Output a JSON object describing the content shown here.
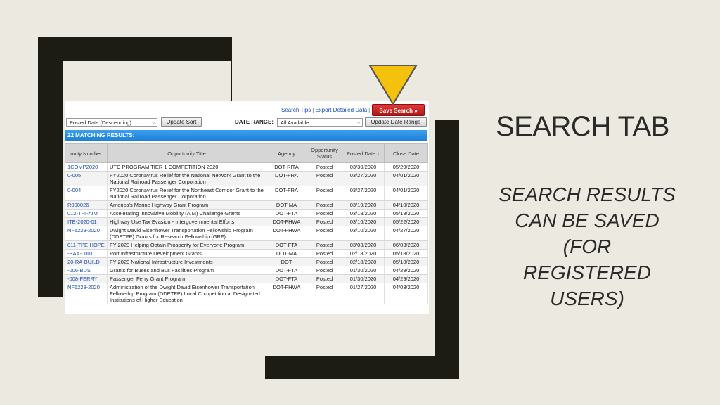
{
  "slide": {
    "heading": "SEARCH TAB",
    "subtext_lines": [
      "SEARCH RESULTS",
      "CAN BE SAVED",
      "(FOR",
      "REGISTERED",
      "USERS)"
    ]
  },
  "toolbar": {
    "search_tips": "Search Tips",
    "separator": "|",
    "export": "Export Detailed Data",
    "save_search": "Save Search »",
    "sort_value": "Posted Date (Descending)",
    "update_sort": "Update Sort",
    "date_range_label": "DATE RANGE:",
    "date_range_value": "All Available",
    "update_date_range": "Update Date Range"
  },
  "results": {
    "banner": "22 MATCHING RESULTS:",
    "columns": [
      "unity Number",
      "Opportunity Title",
      "Agency",
      "Opportunity Status",
      "Posted Date ↓",
      "Close Date"
    ],
    "rows": [
      {
        "number": "1COMP2020",
        "title": "UTC PROGRAM TIER 1 COMPETITION 2020",
        "agency": "DOT-RITA",
        "status": "Posted",
        "posted": "03/30/2020",
        "close": "05/29/2020"
      },
      {
        "number": "0-005",
        "title": "FY2020 Coronavirus Relief for the National Network Grant to the National Railroad Passenger Corporation",
        "agency": "DOT-FRA",
        "status": "Posted",
        "posted": "03/27/2020",
        "close": "04/01/2020"
      },
      {
        "number": "0-004",
        "title": "FY2020 Coronavirus Relief for the Northeast Corridor Grant to the National Railroad Passenger Corporation",
        "agency": "DOT-FRA",
        "status": "Posted",
        "posted": "03/27/2020",
        "close": "04/01/2020"
      },
      {
        "number": "R000026",
        "title": "America's Marine Highway Grant Program",
        "agency": "DOT-MA",
        "status": "Posted",
        "posted": "03/19/2020",
        "close": "04/10/2020"
      },
      {
        "number": "012-TRI-AIM",
        "title": "Accelerating Innovative Mobility (AIM) Challenge Grants",
        "agency": "DOT-FTA",
        "status": "Posted",
        "posted": "03/18/2020",
        "close": "05/18/2020"
      },
      {
        "number": "ITE-2020-01",
        "title": "Highway Use Tax Evasion - Intergovernmental Efforts",
        "agency": "DOT-FHWA",
        "status": "Posted",
        "posted": "03/16/2020",
        "close": "05/22/2020"
      },
      {
        "number": "NF5229-2020",
        "title": "Dwight David Eisenhower Transportation Fellowship Program (DDETFP) Grants for Research Fellowship (GRF)",
        "agency": "DOT-FHWA",
        "status": "Posted",
        "posted": "03/10/2020",
        "close": "04/27/2020"
      },
      {
        "number": "011-TPE-HOPE",
        "title": "FY 2020 Helping Obtain Prosperity for Everyone Program",
        "agency": "DOT-FTA",
        "status": "Posted",
        "posted": "03/03/2020",
        "close": "06/03/2020"
      },
      {
        "number": "-BAA-0001",
        "title": "Port Infrastructure Development Grants",
        "agency": "DOT-MA",
        "status": "Posted",
        "posted": "02/18/2020",
        "close": "05/18/2020"
      },
      {
        "number": "20-RA-BUILD",
        "title": "FY 2020 National Infrastructure Investments",
        "agency": "DOT",
        "status": "Posted",
        "posted": "02/18/2020",
        "close": "05/18/2020"
      },
      {
        "number": "-006-BUS",
        "title": "Grants for Buses and Bus Facilities Program",
        "agency": "DOT-FTA",
        "status": "Posted",
        "posted": "01/30/2020",
        "close": "04/29/2020"
      },
      {
        "number": "-008-FERRY",
        "title": "Passenger Ferry Grant Program",
        "agency": "DOT-FTA",
        "status": "Posted",
        "posted": "01/30/2020",
        "close": "04/29/2020"
      },
      {
        "number": "NF5228-2020",
        "title": "Administration of the Dwight David Eisenhower Transportation Fellowship Program (DDETFP) Local Competition at Designated Institutions of Higher Education",
        "agency": "DOT-FHWA",
        "status": "Posted",
        "posted": "01/27/2020",
        "close": "04/03/2020"
      }
    ]
  },
  "colors": {
    "frame": "#1c1c14",
    "background": "#ece9e1",
    "save_button": "#c41c1c",
    "banner": "#2a8ee6",
    "pointer": "#f4c20d"
  },
  "icons": {
    "pointer": "triangle-pointer-icon",
    "dropdown": "chevron-down-icon"
  }
}
